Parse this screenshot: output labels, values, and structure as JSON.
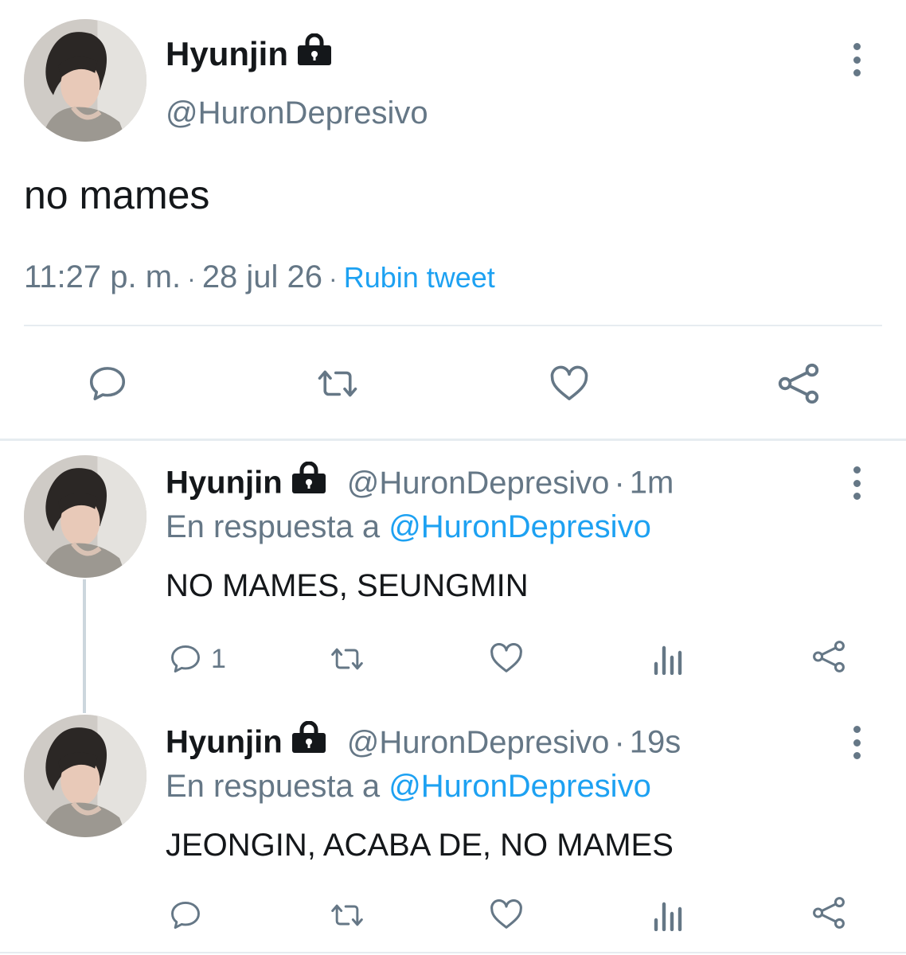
{
  "main_tweet": {
    "author_name": "Hyunjin",
    "author_handle": "@HuronDepresivo",
    "text": "no mames",
    "time": "11:27 p. m.",
    "meta_sep": "·",
    "date": "28 jul 26",
    "source": "Rubin tweet",
    "protected_icon": "lock-icon",
    "actions": [
      "reply-icon",
      "retweet-icon",
      "like-icon",
      "share-icon"
    ]
  },
  "replies": [
    {
      "author_name": "Hyunjin",
      "author_handle": "@HuronDepresivo",
      "sep": "·",
      "time": "1m",
      "replying_to_label": "En respuesta a",
      "replying_to_handle": "@HuronDepresivo",
      "text": "NO MAMES, SEUNGMIN",
      "reply_count": "1"
    },
    {
      "author_name": "Hyunjin",
      "author_handle": "@HuronDepresivo",
      "sep": "·",
      "time": "19s",
      "replying_to_label": "En respuesta a",
      "replying_to_handle": "@HuronDepresivo",
      "text": "JEONGIN, ACABA DE, NO MAMES",
      "reply_count": ""
    }
  ],
  "colors": {
    "text": "#14171a",
    "secondary": "#657786",
    "accent": "#1da1f2",
    "divider": "#e6ecf0"
  }
}
